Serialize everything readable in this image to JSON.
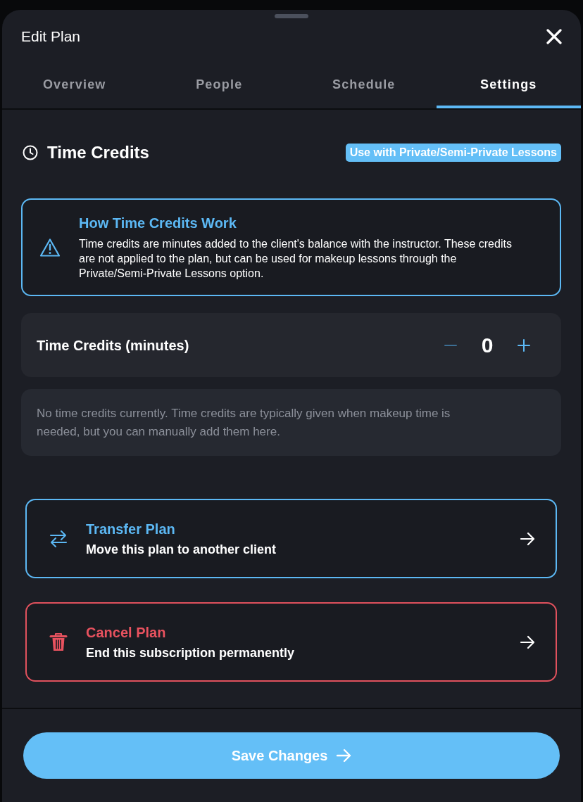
{
  "sheet": {
    "title": "Edit Plan"
  },
  "tabs": [
    {
      "label": "Overview",
      "selected": false
    },
    {
      "label": "People",
      "selected": false
    },
    {
      "label": "Schedule",
      "selected": false
    },
    {
      "label": "Settings",
      "selected": true
    }
  ],
  "section": {
    "title": "Time Credits",
    "badge": "Use with Private/Semi-Private Lessons"
  },
  "info": {
    "title": "How Time Credits Work",
    "body": "Time credits are minutes added to the client's balance with the instructor. These credits are not applied to the plan, but can be used for makeup lessons through the Private/Semi-Private Lessons option."
  },
  "stepper": {
    "label": "Time Credits (minutes)",
    "value": "0",
    "decrement_disabled": true
  },
  "note": "No time credits currently. Time credits are typically given when makeup time is needed, but you can manually add them here.",
  "actions": [
    {
      "kind": "transfer",
      "title": "Transfer Plan",
      "subtitle": "Move this plan to another client"
    },
    {
      "kind": "danger",
      "title": "Cancel Plan",
      "subtitle": "End this subscription permanently"
    }
  ],
  "save_button": {
    "label": "Save Changes"
  }
}
